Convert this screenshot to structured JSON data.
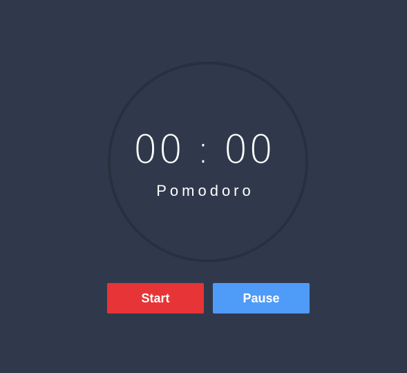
{
  "timer": {
    "time": "00 : 00",
    "mode": "Pomodoro"
  },
  "controls": {
    "start_label": "Start",
    "pause_label": "Pause"
  },
  "colors": {
    "background": "#30394c",
    "ring": "#282f3f",
    "start": "#e73436",
    "pause": "#4f9bf8"
  }
}
